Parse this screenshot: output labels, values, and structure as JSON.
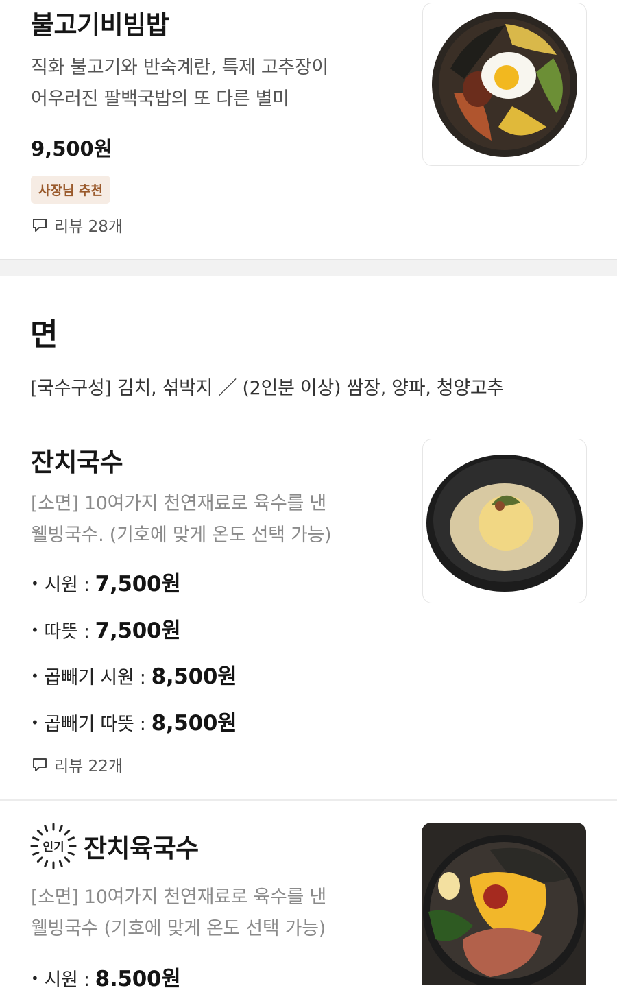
{
  "items": [
    {
      "name": "불고기비빔밥",
      "desc_line1": "직화 불고기와 반숙계란, 특제 고추장이",
      "desc_line2": "어우러진 팔백국밥의 또 다른 별미",
      "price": "9,500원",
      "badge": "사장님 추천",
      "reviews": "리뷰 28개",
      "image_icon": "bibimbap-bowl"
    },
    {
      "name": "잔치국수",
      "desc_line1": "[소면] 10여가지 천연재료로 육수를 낸",
      "desc_line2": "웰빙국수. (기호에 맞게 온도 선택 가능)",
      "options": [
        {
          "label": "시원 :",
          "price": "7,500원"
        },
        {
          "label": "따뜻 :",
          "price": "7,500원"
        },
        {
          "label": "곱빼기 시원 :",
          "price": "8,500원"
        },
        {
          "label": "곱빼기 따뜻 :",
          "price": "8,500원"
        }
      ],
      "reviews": "리뷰 22개",
      "image_icon": "noodle-soup-bowl"
    },
    {
      "name": "잔치육국수",
      "popular_label": "인기",
      "desc_line1": "[소면] 10여가지 천연재료로 육수를 낸",
      "desc_line2": "웰빙국수 (기호에 맞게 온도 선택 가능)",
      "options": [
        {
          "label": "시원 :",
          "price": "8.500원"
        }
      ],
      "image_icon": "meat-noodle-bowl"
    }
  ],
  "section": {
    "title": "면",
    "desc": "[국수구성] 김치, 섞박지 ／ (2인분 이상) 쌈장, 양파, 청양고추"
  },
  "icons": {
    "review": "speech-bubble-icon",
    "popular": "sunburst-badge-icon",
    "bullet": "•"
  },
  "colors": {
    "badge_bg": "#f6ece4",
    "badge_text": "#9a5a2c",
    "divider": "#f2f2f2"
  }
}
